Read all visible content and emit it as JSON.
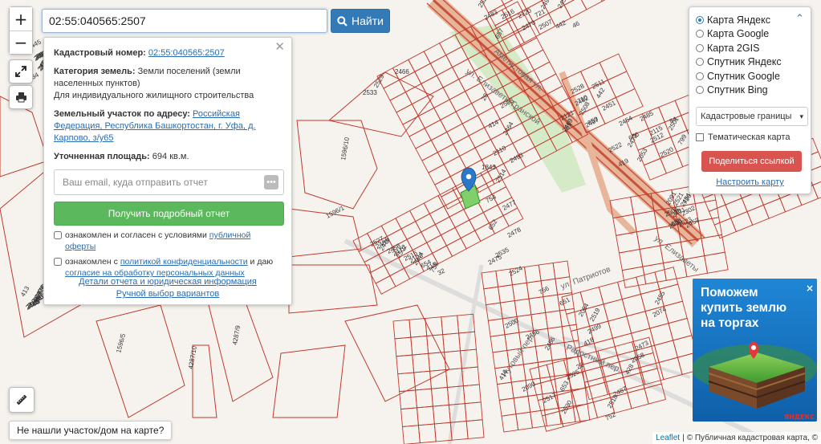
{
  "search": {
    "value": "02:55:040565:2507",
    "button_label": "Найти"
  },
  "zoom": {
    "in_label": "+",
    "out_label": "−"
  },
  "icons": {
    "search": "search-icon",
    "fullscreen": "expand-icon",
    "print": "printer-icon",
    "ruler": "ruler-icon",
    "close": "close-icon",
    "chevron": "chevron-up-icon",
    "marker": "map-marker-icon"
  },
  "info": {
    "cadastral_label": "Кадастровый номер:",
    "cadastral_value": "02:55:040565:2507",
    "category_label": "Категория земель:",
    "category_value": "Земли поселений (земли населенных пунктов)",
    "use_value": "Для индивидуального жилищного строительства",
    "address_label": "Земельный участок по адресу:",
    "address_value": "Российская Федерация, Республика Башкортостан, г. Уфа, д. Карпово, з/у65",
    "area_label": "Уточненная площадь:",
    "area_value": "694 кв.м.",
    "email_placeholder": "Ваш email, куда отправить отчет",
    "report_button": "Получить подробный отчет",
    "agree1_prefix": "ознакомлен и согласен с условиями",
    "agree1_link": "публичной оферты",
    "agree2_prefix": "ознакомлен с",
    "agree2_link": "политикой конфиденциальности",
    "agree2_mid": "и даю",
    "agree2_link2": "согласие на обработку персональных данных",
    "details_link": "Детали отчета и юридическая информация",
    "manual_link": "Ручной выбор вариантов"
  },
  "layers": {
    "options": [
      {
        "label": "Карта Яндекс",
        "selected": true
      },
      {
        "label": "Карта Google",
        "selected": false
      },
      {
        "label": "Карта 2GIS",
        "selected": false
      },
      {
        "label": "Спутник Яндекс",
        "selected": false
      },
      {
        "label": "Спутник Google",
        "selected": false
      },
      {
        "label": "Спутник Bing",
        "selected": false
      }
    ],
    "overlay_select": "Кадастровые границы",
    "thematic_label": "Тематическая карта",
    "share_button": "Поделиться ссылкой",
    "configure_link": "Настроить карту"
  },
  "ad": {
    "line1": "Поможем",
    "line2": "купить землю",
    "line3": "на торгах",
    "brand": "ЯНДЕКС",
    "close": "×"
  },
  "not_found_button": "Не нашли участок/дом на карте?",
  "attribution": {
    "leaflet": "Leaflet",
    "sep": "|",
    "copy": "© Публичная кадастровая карта, ©"
  },
  "map": {
    "colors": {
      "parcel": "#c0392b",
      "road_outer": "#e8b59a",
      "road_inner": "#c6543b",
      "park": "#cfe9bf",
      "selected": "#7fd06a",
      "marker": "#2b78c8"
    },
    "streets": [
      "ул. Елизаветы Гранской",
      "Аметистовая ул.",
      "ул. Елизаветы",
      "ул. Патриотов",
      "Радостный пер.",
      "Нутовый пер."
    ],
    "parcel_labels": [
      "1596/10",
      "1596/1",
      "1596/5",
      "4287/10",
      "4287/9",
      "1843",
      "2466",
      "2533",
      "2529",
      "2527",
      "2524",
      "2519",
      "2512",
      "2506",
      "2498",
      "2497",
      "2495",
      "2494",
      "2493",
      "2489",
      "2486",
      "2487",
      "2485",
      "2484",
      "2483",
      "2482",
      "2481",
      "2480",
      "2478",
      "2476",
      "2475",
      "2473",
      "2472",
      "2471",
      "2470",
      "2469",
      "2468",
      "2465",
      "2464",
      "2458",
      "2456",
      "2455",
      "2454",
      "2453",
      "2450",
      "2451",
      "2452",
      "2474",
      "2477",
      "2479",
      "2530",
      "2525",
      "2522",
      "2521",
      "2516",
      "2511",
      "2509",
      "2505",
      "2503",
      "2502",
      "2500",
      "2499",
      "2501",
      "2504",
      "2507",
      "2508",
      "2510",
      "2513",
      "2514",
      "2515",
      "2517",
      "2518",
      "2520",
      "2523",
      "2526",
      "2528",
      "2531",
      "2532",
      "2535",
      "2123",
      "2054",
      "2058",
      "2115",
      "2091",
      "2120",
      "2121",
      "2346",
      "2097",
      "2110",
      "2044",
      "2090",
      "2074",
      "2053",
      "2302",
      "442",
      "442",
      "445",
      "650",
      "652",
      "654",
      "651",
      "653",
      "656",
      "655",
      "657",
      "659",
      "660",
      "413",
      "414",
      "415",
      "416",
      "418",
      "419",
      "720",
      "721",
      "710",
      "715",
      "718",
      "754",
      "758",
      "756",
      "752",
      "799",
      "76",
      "46",
      "61",
      "34",
      "26",
      "28",
      "32",
      "22",
      "428",
      "84"
    ]
  }
}
